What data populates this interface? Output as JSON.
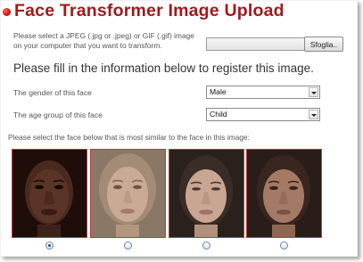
{
  "header": {
    "title": "Face Transformer Image Upload"
  },
  "upload": {
    "instructions": "Please select a JPEG (.jpg or .jpeg) or GIF (.gif) image on your computer that you want to transform.",
    "file_value": "",
    "browse_label": "Sfoglia.."
  },
  "register": {
    "heading": "Please fill in the information below to register this image."
  },
  "fields": {
    "gender": {
      "label": "The gender of this face",
      "value": "Male"
    },
    "age": {
      "label": "The age group of this face",
      "value": "Child"
    }
  },
  "similar": {
    "prompt": "Please select the face below that is most similar to the face in this image:",
    "faces": [
      {
        "icon": "face-dark-skin",
        "selected": true
      },
      {
        "icon": "face-light-skin",
        "selected": false
      },
      {
        "icon": "face-east-asian",
        "selected": false
      },
      {
        "icon": "face-south-asian",
        "selected": false
      }
    ]
  },
  "colors": {
    "title": "#a01a1c",
    "face_border": "#b04040",
    "text": "#555555"
  }
}
